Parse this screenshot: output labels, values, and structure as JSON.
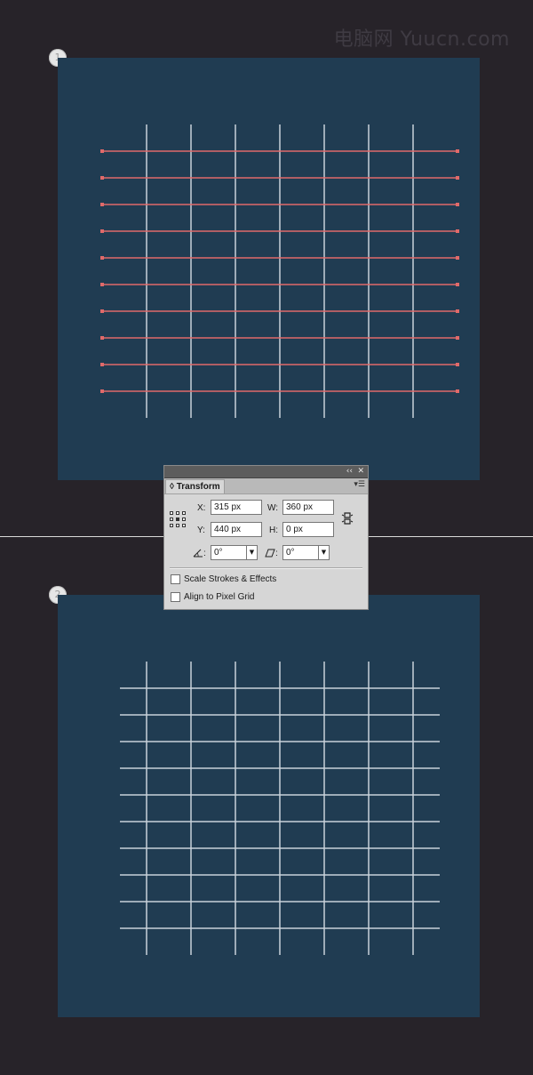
{
  "watermark": "电脑网 Yuucn.com",
  "steps": [
    {
      "number": "1"
    },
    {
      "number": "2"
    }
  ],
  "colors": {
    "background": "#272329",
    "artboard": "#203c52",
    "vertical_lines": "#c8d2d9",
    "selected_lines": "#e06a6a",
    "final_lines": "#c8d2d9"
  },
  "panel": {
    "collapse_icon": "double-chevron-left-icon",
    "close_icon": "close-icon",
    "tab_label": "Transform",
    "menu_icon": "panel-menu-icon",
    "x_label": "X:",
    "x_value": "315 px",
    "y_label": "Y:",
    "y_value": "440 px",
    "w_label": "W:",
    "w_value": "360 px",
    "h_label": "H:",
    "h_value": "0 px",
    "rotate_label": ":",
    "rotate_value": "0°",
    "shear_label": ":",
    "shear_value": "0°",
    "scale_strokes_label": "Scale Strokes & Effects",
    "scale_strokes_checked": false,
    "align_pixel_label": "Align to Pixel Grid",
    "align_pixel_checked": false
  }
}
